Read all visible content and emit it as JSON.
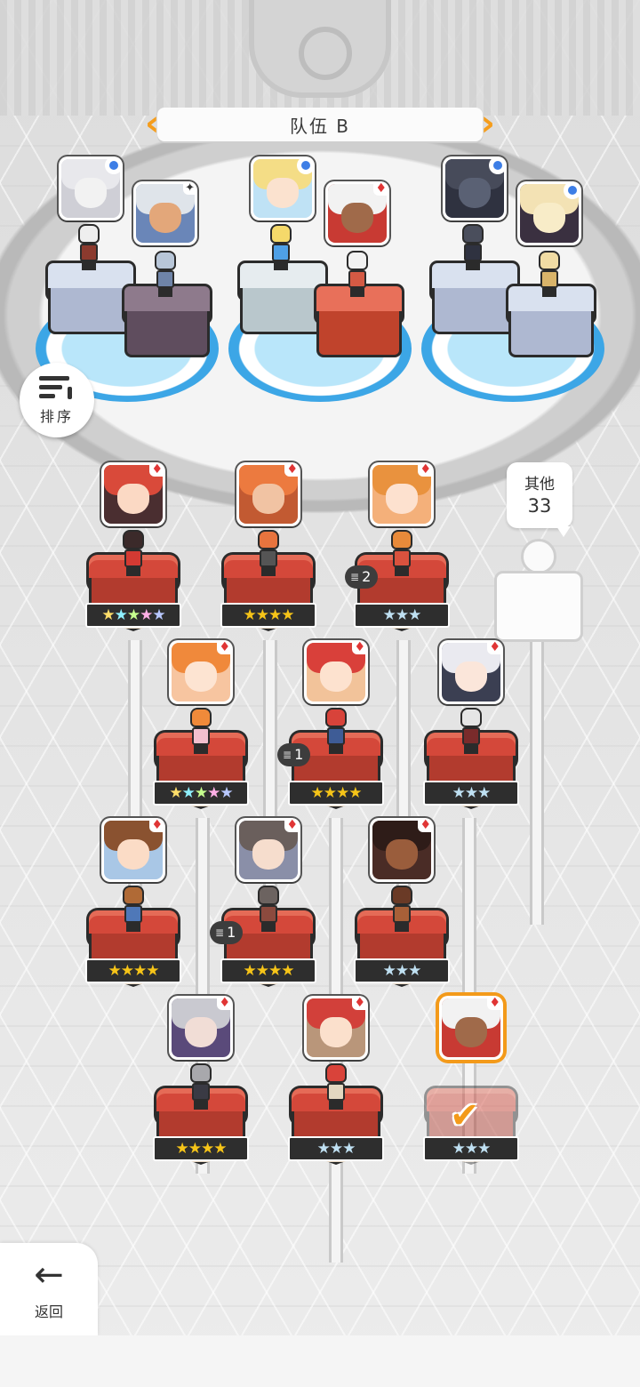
{
  "team": {
    "title": "队伍 B"
  },
  "sort_button": {
    "label": "排序"
  },
  "back_button": {
    "label": "返回"
  },
  "others": {
    "label": "其他",
    "count": "33"
  },
  "colors": {
    "accent": "#f39a1a",
    "team_pool": "#3ca6e6",
    "pedestal_red": "#d4483a"
  },
  "team_slots": [
    {
      "name": "wolf-warrior",
      "badge": "blue-dot"
    },
    {
      "name": "old-knight",
      "badge": "sparkle"
    },
    {
      "name": "blonde-princess",
      "badge": "blue-dot"
    },
    {
      "name": "white-haired-mystic",
      "badge": "red-diamond"
    },
    {
      "name": "dark-dragon",
      "badge": "blue-dot"
    },
    {
      "name": "cream-beast",
      "badge": "blue-dot"
    }
  ],
  "roster": [
    {
      "name": "witch-red",
      "stars": 5,
      "star_type": "rainbow",
      "dup": ""
    },
    {
      "name": "orange-brawler",
      "stars": 4,
      "star_type": "gold",
      "dup": ""
    },
    {
      "name": "cheerful-girl",
      "stars": 3,
      "star_type": "silver",
      "dup": "2"
    },
    {
      "name": "orange-hair-girl",
      "stars": 5,
      "star_type": "rainbow",
      "dup": ""
    },
    {
      "name": "red-hair-girl",
      "stars": 4,
      "star_type": "gold",
      "dup": "1"
    },
    {
      "name": "silver-hair-girl",
      "stars": 3,
      "star_type": "silver",
      "dup": ""
    },
    {
      "name": "brown-hair-boy",
      "stars": 4,
      "star_type": "gold",
      "dup": ""
    },
    {
      "name": "hat-girl",
      "stars": 4,
      "star_type": "gold",
      "dup": "1"
    },
    {
      "name": "dark-fighter",
      "stars": 3,
      "star_type": "silver",
      "dup": ""
    },
    {
      "name": "grey-hair-mage",
      "stars": 4,
      "star_type": "gold",
      "dup": ""
    },
    {
      "name": "red-hair-boy",
      "stars": 3,
      "star_type": "silver",
      "dup": ""
    },
    {
      "name": "white-haired-mystic-selected",
      "stars": 3,
      "star_type": "silver",
      "dup": "",
      "selected": true
    }
  ]
}
